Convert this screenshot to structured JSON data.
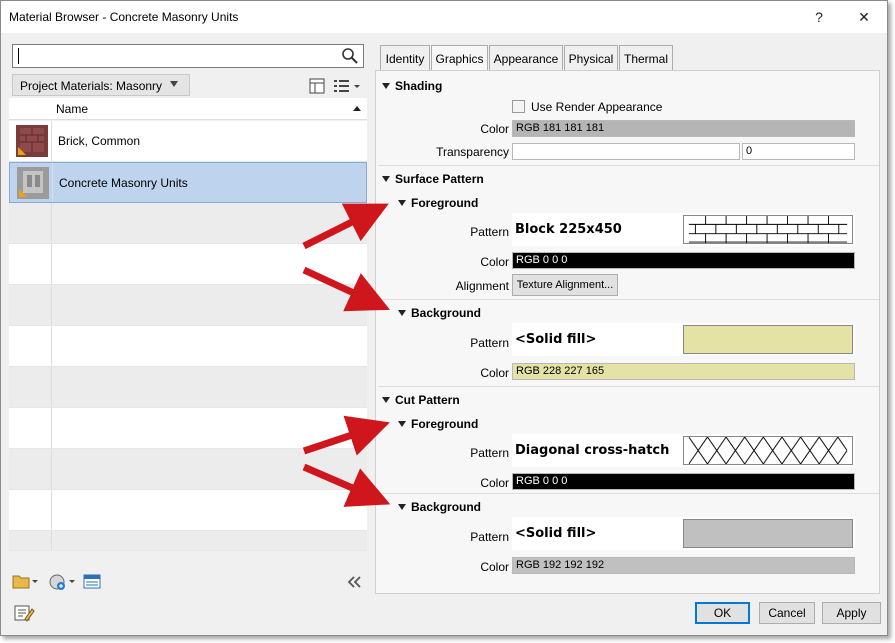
{
  "window": {
    "title": "Material Browser - Concrete Masonry Units",
    "help": "?",
    "close": "✕"
  },
  "left": {
    "search_value": "",
    "breadcrumb": "Project Materials: Masonry",
    "column_header": "Name",
    "items": [
      {
        "name": "Brick, Common"
      },
      {
        "name": "Concrete Masonry Units"
      }
    ]
  },
  "tabs": [
    "Identity",
    "Graphics",
    "Appearance",
    "Physical",
    "Thermal"
  ],
  "shading": {
    "title": "Shading",
    "use_render_label": "Use Render Appearance",
    "color_label": "Color",
    "color_value": "RGB 181 181 181",
    "color_hex": "#b5b5b5",
    "transparency_label": "Transparency",
    "transparency_value": "0"
  },
  "surface": {
    "title": "Surface Pattern",
    "fg_title": "Foreground",
    "fg_pattern_label": "Pattern",
    "fg_pattern": "Block 225x450",
    "fg_color_label": "Color",
    "fg_color": "RGB 0 0 0",
    "alignment_label": "Alignment",
    "alignment_button": "Texture Alignment...",
    "bg_title": "Background",
    "bg_pattern_label": "Pattern",
    "bg_pattern": "<Solid fill>",
    "bg_color_label": "Color",
    "bg_color": "RGB 228 227 165",
    "bg_color_hex": "#e4e3a5"
  },
  "cut": {
    "title": "Cut Pattern",
    "fg_title": "Foreground",
    "fg_pattern_label": "Pattern",
    "fg_pattern": "Diagonal cross-hatch",
    "fg_color_label": "Color",
    "fg_color": "RGB 0 0 0",
    "bg_title": "Background",
    "bg_pattern_label": "Pattern",
    "bg_pattern": "<Solid fill>",
    "bg_color_label": "Color",
    "bg_color": "RGB 192 192 192",
    "bg_color_hex": "#c0c0c0"
  },
  "footer": {
    "ok": "OK",
    "cancel": "Cancel",
    "apply": "Apply"
  }
}
